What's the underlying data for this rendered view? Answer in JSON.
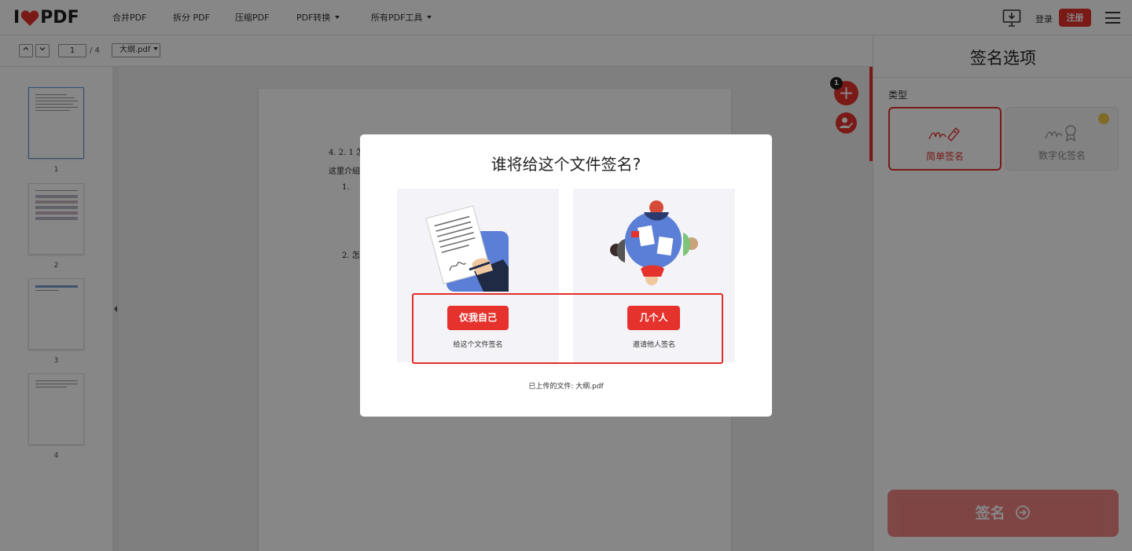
{
  "nav": {
    "items": [
      {
        "label": "合并PDF"
      },
      {
        "label": "拆分 PDF"
      },
      {
        "label": "压缩PDF"
      },
      {
        "label": "PDF转换"
      },
      {
        "label": "所有PDF工具"
      }
    ],
    "login": "登录",
    "register": "注册",
    "logo_left": "I",
    "logo_right": "PDF"
  },
  "toolbar": {
    "page_current": "1",
    "page_total": "/ 4",
    "file_name": "大纲.pdf"
  },
  "thumbnails": [
    {
      "num": "1"
    },
    {
      "num": "2"
    },
    {
      "num": "3"
    },
    {
      "num": "4"
    }
  ],
  "document": {
    "heading": "4. 2. 1 怎",
    "intro": "这里介绍",
    "item1": "1.",
    "item2": "2. 怎"
  },
  "fab": {
    "badge": "1"
  },
  "panel": {
    "title": "签名选项",
    "type_label": "类型",
    "simple_label": "简单签名",
    "digital_label": "数字化签名",
    "sign_button": "签名"
  },
  "modal": {
    "title": "谁将给这个文件签名?",
    "me_button": "仅我自己",
    "me_desc": "给这个文件签名",
    "many_button": "几个人",
    "many_desc": "邀请他人签名",
    "uploaded": "已上传的文件: 大纲.pdf"
  },
  "colors": {
    "brand": "#e5322d",
    "highlight": "#e02f2a"
  }
}
